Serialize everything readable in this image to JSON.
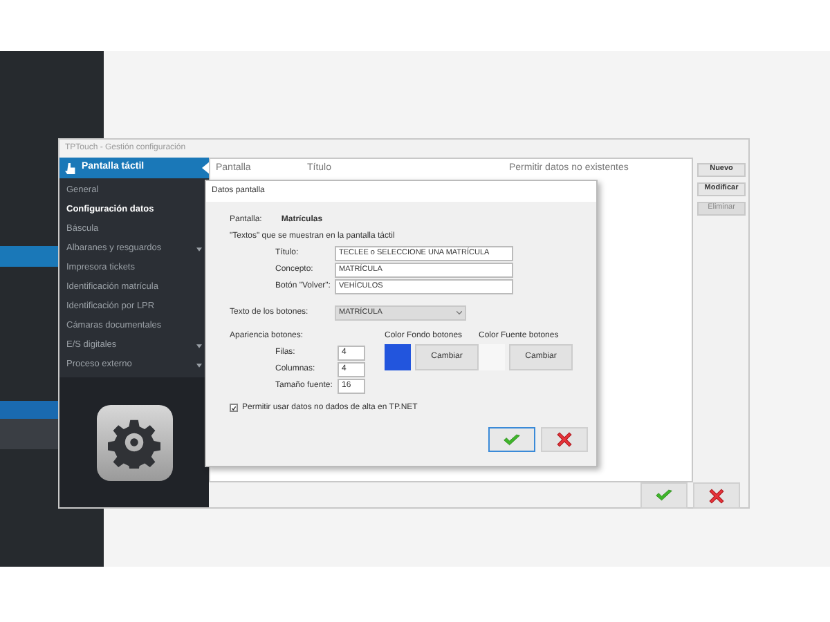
{
  "window": {
    "title": "TPTouch - Gestión configuración"
  },
  "sidebar": {
    "header": "Pantalla táctil",
    "items": [
      {
        "label": "General",
        "selected": false,
        "submenu": false
      },
      {
        "label": "Configuración datos",
        "selected": true,
        "submenu": false
      },
      {
        "label": "Báscula",
        "selected": false,
        "submenu": false
      },
      {
        "label": "Albaranes y resguardos",
        "selected": false,
        "submenu": true
      },
      {
        "label": "Impresora tickets",
        "selected": false,
        "submenu": false
      },
      {
        "label": "Identificación matrícula",
        "selected": false,
        "submenu": false
      },
      {
        "label": "Identificación por LPR",
        "selected": false,
        "submenu": false
      },
      {
        "label": "Cámaras documentales",
        "selected": false,
        "submenu": false
      },
      {
        "label": "E/S digitales",
        "selected": false,
        "submenu": true
      },
      {
        "label": "Proceso externo",
        "selected": false,
        "submenu": true
      }
    ]
  },
  "table": {
    "columns": [
      "Pantalla",
      "Título",
      "Permitir datos no existentes"
    ]
  },
  "side_buttons": [
    {
      "label": "Nuevo",
      "disabled": false
    },
    {
      "label": "Modificar",
      "disabled": false
    },
    {
      "label": "Eliminar",
      "disabled": true
    }
  ],
  "dialog": {
    "title": "Datos pantalla",
    "screen_label": "Pantalla:",
    "screen_value": "Matrículas",
    "texts_heading": "\"Textos\" que se muestran en la pantalla táctil",
    "fields": [
      {
        "label": "Título:",
        "value": "TECLEE o SELECCIONE UNA MATRÍCULA"
      },
      {
        "label": "Concepto:",
        "value": "MATRÍCULA"
      },
      {
        "label": "Botón \"Volver\":",
        "value": "VEHÍCULOS"
      }
    ],
    "buttons_text_label": "Texto de los botones:",
    "buttons_text_value": "MATRÍCULA",
    "appearance_heading": "Apariencia botones:",
    "appearance_fields": [
      {
        "label": "Filas:",
        "value": "4"
      },
      {
        "label": "Columnas:",
        "value": "4"
      },
      {
        "label": "Tamaño fuente:",
        "value": "16"
      }
    ],
    "colors": [
      {
        "label": "Color Fondo botones",
        "color": "#2255dd",
        "button": "Cambiar"
      },
      {
        "label": "Color Fuente botones",
        "color": "#f7f7f7",
        "button": "Cambiar"
      }
    ],
    "checkbox": {
      "label": "Permitir usar datos no dados de alta en TP.NET",
      "checked": true
    }
  }
}
